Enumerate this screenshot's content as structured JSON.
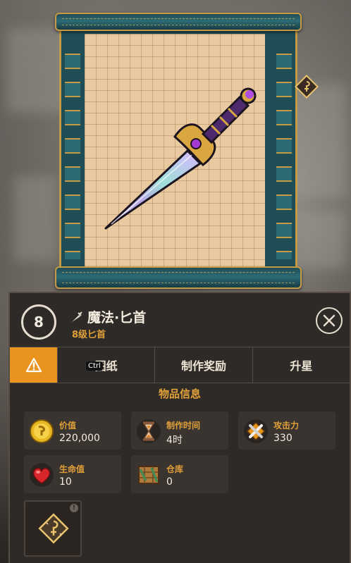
{
  "item": {
    "level": "8",
    "name": "魔法·匕首",
    "subtitle": "8级匕首"
  },
  "tabs": [
    {
      "label": "",
      "icon": "warning-icon",
      "active": true
    },
    {
      "label": "图纸",
      "badge": "Ctrl"
    },
    {
      "label": "制作奖励"
    },
    {
      "label": "升星"
    }
  ],
  "info": {
    "section_title": "物品信息",
    "stats": [
      {
        "label": "价值",
        "value": "220,000",
        "icon": "gold-coin-icon"
      },
      {
        "label": "制作时间",
        "value": "4时",
        "icon": "hourglass-icon"
      },
      {
        "label": "攻击力",
        "value": "330",
        "icon": "attack-swords-icon"
      },
      {
        "label": "生命值",
        "value": "10",
        "icon": "heart-icon"
      },
      {
        "label": "仓库",
        "value": "0",
        "icon": "crate-icon"
      }
    ]
  },
  "colors": {
    "accent": "#e0a03a",
    "active_tab": "#e8941f",
    "panel_bg": "#2e2a27",
    "scroll_teal": "#1f4d56",
    "paper": "#e8c9a0"
  }
}
